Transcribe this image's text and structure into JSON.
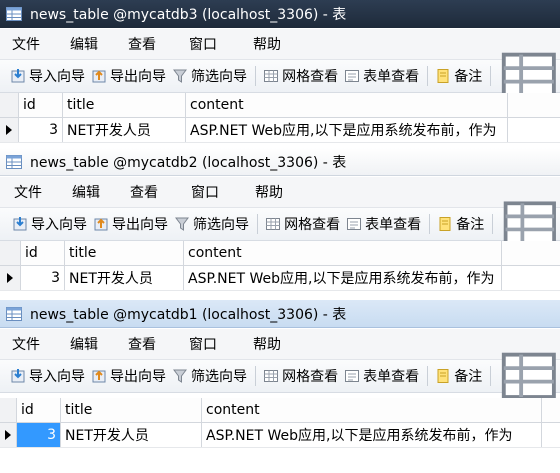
{
  "windows": [
    {
      "title": "news_table @mycatdb3 (localhost_3306) - 表",
      "menu": [
        "文件",
        "编辑",
        "查看",
        "窗口",
        "帮助"
      ],
      "toolbar": {
        "import": "导入向导",
        "export": "导出向导",
        "filter": "筛选向导",
        "grid_view": "网格查看",
        "form_view": "表单查看",
        "memo": "备注"
      },
      "columns": [
        "id",
        "title",
        "content"
      ],
      "rows": [
        {
          "id": "3",
          "title": "NET开发人员",
          "content": "ASP.NET Web应用,以下是应用系统发布前，作为"
        }
      ]
    },
    {
      "title": "news_table @mycatdb2 (localhost_3306) - 表",
      "menu": [
        "文件",
        "编辑",
        "查看",
        "窗口",
        "帮助"
      ],
      "toolbar": {
        "import": "导入向导",
        "export": "导出向导",
        "filter": "筛选向导",
        "grid_view": "网格查看",
        "form_view": "表单查看",
        "memo": "备注"
      },
      "columns": [
        "id",
        "title",
        "content"
      ],
      "rows": [
        {
          "id": "3",
          "title": "NET开发人员",
          "content": "ASP.NET Web应用,以下是应用系统发布前，作为"
        }
      ]
    },
    {
      "title": "news_table @mycatdb1 (localhost_3306) - 表",
      "menu": [
        "文件",
        "编辑",
        "查看",
        "窗口",
        "帮助"
      ],
      "toolbar": {
        "import": "导入向导",
        "export": "导出向导",
        "filter": "筛选向导",
        "grid_view": "网格查看",
        "form_view": "表单查看",
        "memo": "备注"
      },
      "columns": [
        "id",
        "title",
        "content"
      ],
      "rows": [
        {
          "id": "3",
          "title": "NET开发人员",
          "content": "ASP.NET Web应用,以下是应用系统发布前，作为"
        }
      ]
    }
  ]
}
